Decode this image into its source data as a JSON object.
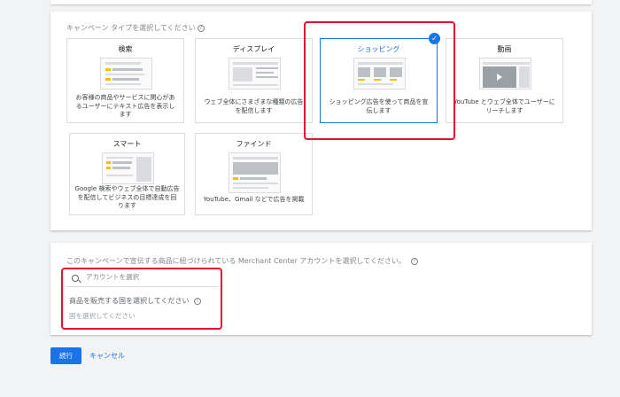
{
  "campaign_type": {
    "heading": "キャンペーン タイプを選択してください",
    "tiles": [
      {
        "title": "検索",
        "desc": [
          "お客様の商品やサービスに関心があ",
          "るユーザーにテキスト広告を表示し",
          "ます"
        ]
      },
      {
        "title": "ディスプレイ",
        "desc": [
          "ウェブ全体にさまざまな種類の広告",
          "を配信します"
        ]
      },
      {
        "title": "ショッピング",
        "desc": [
          "ショッピング広告を使って商品を宣",
          "伝します"
        ],
        "selected": true
      },
      {
        "title": "動画",
        "desc": [
          "YouTube とウェブ全体でユーザーに",
          "リーチします"
        ]
      },
      {
        "title": "スマート",
        "desc": [
          "Google 検索やウェブ全体で自動広告",
          "を配信してビジネスの目標達成を回",
          "ります"
        ]
      },
      {
        "title": "ファインド",
        "desc": [
          "YouTube、Gmail などで広告を掲載"
        ]
      }
    ]
  },
  "merchant": {
    "heading": "このキャンペーンで宣伝する商品に紐づけられている Merchant Center アカウントを選択してください。",
    "search_placeholder": "アカウントを選択",
    "country_label": "商品を販売する国を選択してください",
    "country_placeholder": "国を選択してください"
  },
  "actions": {
    "continue_label": "続行",
    "cancel_label": "キャンセル"
  },
  "icons": {
    "help": "?",
    "check": "✓"
  },
  "colors": {
    "accent": "#1a73e8",
    "highlight": "#e8112d",
    "thumb_yellow": "#fbbc04"
  }
}
